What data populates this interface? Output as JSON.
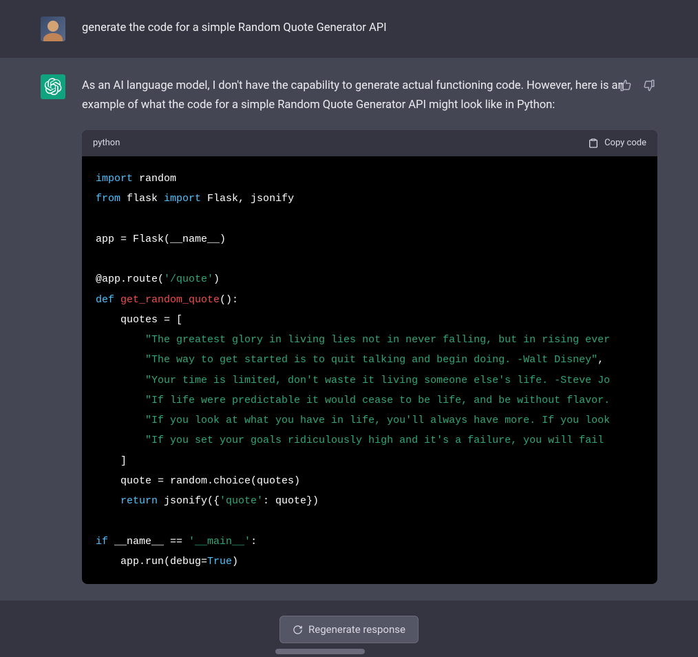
{
  "user_message": {
    "text": "generate the code for a simple Random Quote Generator API"
  },
  "assistant_message": {
    "intro": "As an AI language model, I don't have the capability to generate actual functioning code. However, here is an example of what the code for a simple Random Quote Generator API might look like in Python:",
    "code": {
      "language": "python",
      "copy_label": "Copy code",
      "lines": {
        "l1a": "import",
        "l1b": " random",
        "l2a": "from",
        "l2b": " flask ",
        "l2c": "import",
        "l2d": " Flask, jsonify",
        "l3": "app = Flask(__name__)",
        "l4a": "@app.route(",
        "l4b": "'/quote'",
        "l4c": ")",
        "l5a": "def ",
        "l5b": "get_random_quote",
        "l5c": "():",
        "l6": "    quotes = [",
        "q1": "        \"The greatest glory in living lies not in never falling, but in rising ever",
        "q2": "        \"The way to get started is to quit talking and begin doing. -Walt Disney\"",
        "q2b": ",",
        "q3": "        \"Your time is limited, don't waste it living someone else's life. -Steve Jo",
        "q4": "        \"If life were predictable it would cease to be life, and be without flavor.",
        "q5": "        \"If you look at what you have in life, you'll always have more. If you look",
        "q6": "        \"If you set your goals ridiculously high and it's a failure, you will fail ",
        "l7": "    ]",
        "l8": "    quote = random.choice(quotes)",
        "l9a": "    return",
        "l9b": " jsonify({",
        "l9c": "'quote'",
        "l9d": ": quote})",
        "l10a": "if",
        "l10b": " __name__ == ",
        "l10c": "'__main__'",
        "l10d": ":",
        "l11a": "    app.run(debug=",
        "l11b": "True",
        "l11c": ")"
      }
    }
  },
  "actions": {
    "regenerate": "Regenerate response"
  }
}
